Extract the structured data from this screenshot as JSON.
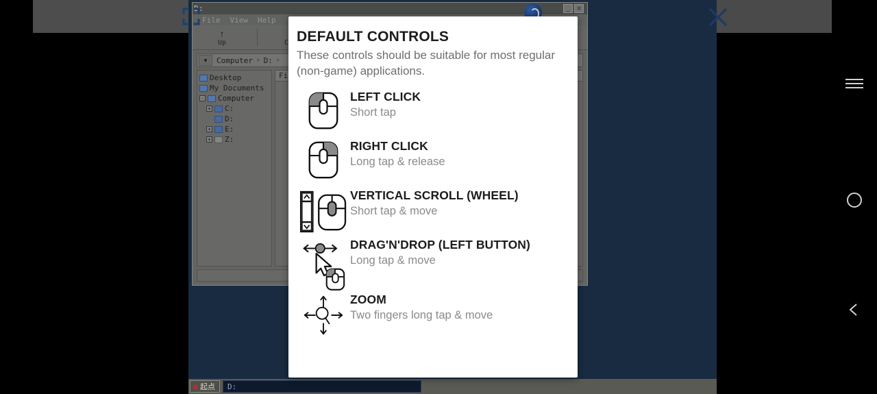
{
  "dialog": {
    "title": "DEFAULT CONTROLS",
    "subtitle": "These controls should be suitable for most regular (non-game) applications.",
    "items": [
      {
        "icon": "mouse-left-button-icon",
        "title": "LEFT CLICK",
        "desc": "Short tap"
      },
      {
        "icon": "mouse-right-button-icon",
        "title": "RIGHT CLICK",
        "desc": "Long tap & release"
      },
      {
        "icon": "scrollbar-wheel-icon",
        "title": "VERTICAL SCROLL (WHEEL)",
        "desc": "Short tap & move"
      },
      {
        "icon": "drag-cursor-icon",
        "title": "DRAG'N'DROP (LEFT BUTTON)",
        "desc": "Long tap & move"
      },
      {
        "icon": "zoom-magnifier-icon",
        "title": "ZOOM",
        "desc": "Two fingers long tap & move"
      }
    ]
  },
  "chrome": {
    "fullscreen_icon": "fullscreen-brackets-icon",
    "close_icon": "close-x-icon",
    "navbar": {
      "menu_icon": "hamburger-menu-icon",
      "home_icon": "home-circle-icon",
      "back_icon": "back-chevron-icon"
    }
  },
  "remote": {
    "window": {
      "title": "D:",
      "menus": [
        "File",
        "View",
        "Help"
      ],
      "help_icon": "help-question-icon",
      "window_buttons": [
        {
          "name": "minimize-button",
          "glyph": "_"
        },
        {
          "name": "close-button",
          "glyph": "×"
        }
      ],
      "toolbar": [
        {
          "name": "up-button",
          "glyph": "↑",
          "label": "Up"
        },
        {
          "name": "copy-button",
          "glyph": "❐",
          "label": "Copy"
        }
      ],
      "breadcrumb": {
        "dropdown_icon": "chevron-down-icon",
        "parts": [
          "Computer",
          "D:"
        ],
        "separator": "›"
      },
      "tree": [
        {
          "label": "Desktop",
          "level": 0,
          "expander": "",
          "icon": "desktop-icon"
        },
        {
          "label": "My Documents",
          "level": 0,
          "expander": "",
          "icon": "documents-icon"
        },
        {
          "label": "Computer",
          "level": 0,
          "expander": "-",
          "icon": "computer-icon"
        },
        {
          "label": "C:",
          "level": 1,
          "expander": "+",
          "icon": "drive-icon"
        },
        {
          "label": "D:",
          "level": 1,
          "expander": "",
          "icon": "drive-icon"
        },
        {
          "label": "E:",
          "level": 1,
          "expander": "+",
          "icon": "drive-icon"
        },
        {
          "label": "Z:",
          "level": 1,
          "expander": "+",
          "icon": "drive-blank-icon"
        }
      ],
      "list_column_header": "Fi"
    },
    "taskbar": {
      "start_label": "起点",
      "task_label": "D:"
    }
  },
  "colors": {
    "desktop_bg": "#182b40",
    "card_bg": "#ffffff",
    "title_text": "#1c1c1c",
    "muted_text": "#8a8a8a",
    "accent_dark_blue": "#1f3a63",
    "icon_shade_gray": "#808080"
  }
}
